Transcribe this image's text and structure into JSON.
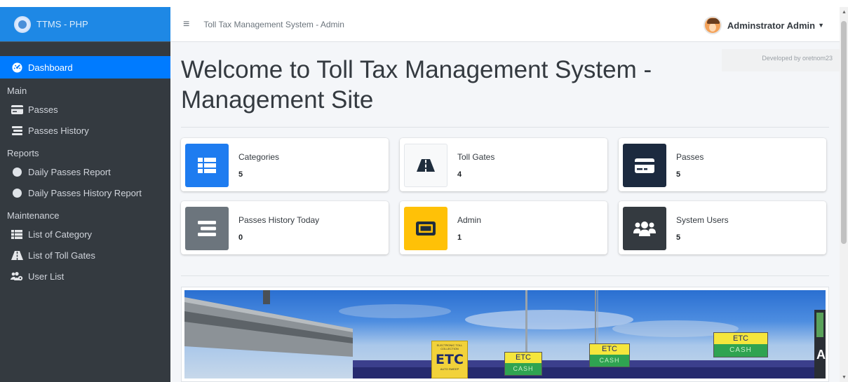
{
  "brand": {
    "name": "TTMS - PHP"
  },
  "topbar": {
    "title": "Toll Tax Management System - Admin",
    "user_name": "Adminstrator Admin"
  },
  "sidebar": {
    "dashboard": "Dashboard",
    "main_header": "Main",
    "passes": "Passes",
    "passes_history": "Passes History",
    "reports_header": "Reports",
    "daily_passes_report": "Daily Passes Report",
    "daily_passes_history_report": "Daily Passes History Report",
    "maintenance_header": "Maintenance",
    "list_of_category": "List of Category",
    "list_of_toll_gates": "List of Toll Gates",
    "user_list": "User List"
  },
  "main": {
    "title": "Welcome to Toll Tax Management System - Management Site",
    "developer_badge": "Developed by oretnom23",
    "cards": [
      {
        "label": "Categories",
        "value": "5",
        "icon": "list-icon",
        "color": "#1e7cf0"
      },
      {
        "label": "Toll Gates",
        "value": "4",
        "icon": "road-icon",
        "color": "#f8f9fa"
      },
      {
        "label": "Passes",
        "value": "5",
        "icon": "credit-card-icon",
        "color": "#1c2a3f"
      },
      {
        "label": "Passes History Today",
        "value": "0",
        "icon": "stream-icon",
        "color": "#6c757d"
      },
      {
        "label": "Admin",
        "value": "1",
        "icon": "id-card-icon",
        "color": "#ffc107"
      },
      {
        "label": "System Users",
        "value": "5",
        "icon": "users-icon",
        "color": "#343a40"
      }
    ],
    "photo": {
      "sign_etc_main": "ETC",
      "sign_etc_header": "ELECTRONIC TOLL COLLECTION",
      "sign_etc_footer": "AUTO SWEEP",
      "sign_1_top": "ETC",
      "sign_1_bottom": "CASH",
      "sign_2_top": "ETC",
      "sign_2_bottom": "CASH",
      "sign_3_top": "ETC",
      "sign_3_bottom": "CASH",
      "edge_letters": "A"
    }
  }
}
